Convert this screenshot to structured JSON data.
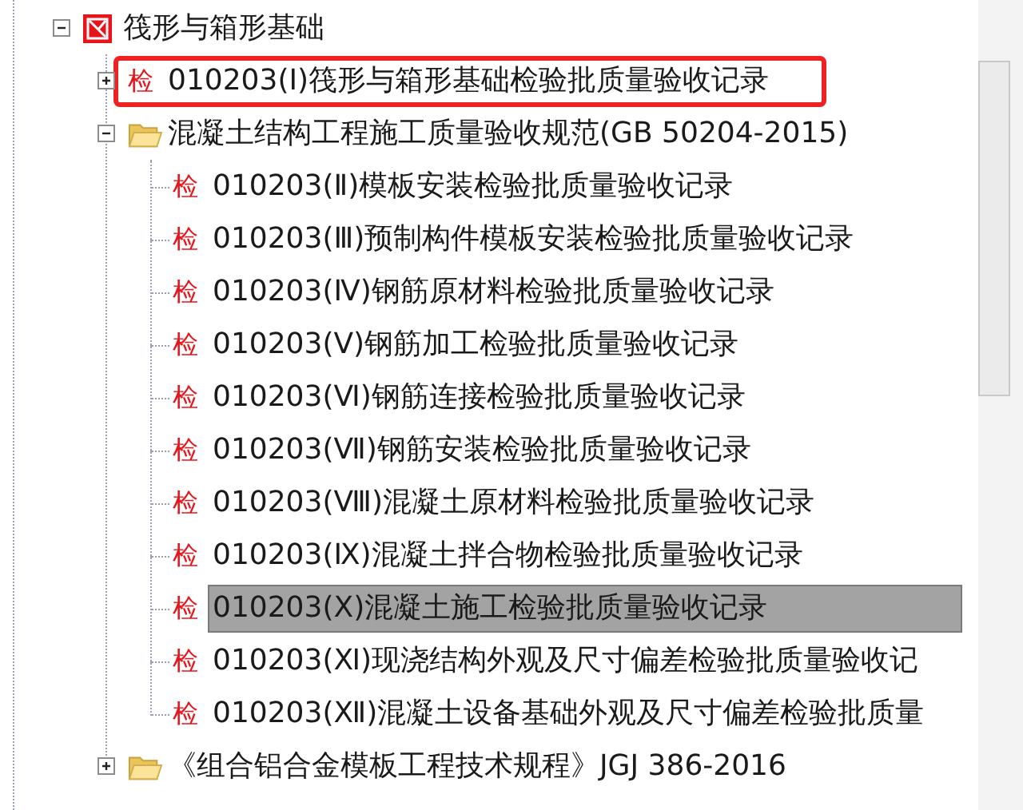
{
  "tree": [
    {
      "kind": "category",
      "label": "筏形与箱形基础",
      "expanded": true,
      "children": [
        {
          "kind": "record",
          "badge": "检",
          "label": "010203(Ⅰ)筏形与箱形基础检验批质量验收记录",
          "expanded": false,
          "marked": true,
          "selected": false
        },
        {
          "kind": "folder",
          "label": "混凝土结构工程施工质量验收规范(GB 50204-2015)",
          "expanded": true,
          "children": [
            {
              "kind": "record",
              "badge": "检",
              "label": "010203(Ⅱ)模板安装检验批质量验收记录",
              "selected": false
            },
            {
              "kind": "record",
              "badge": "检",
              "label": "010203(Ⅲ)预制构件模板安装检验批质量验收记录",
              "selected": false
            },
            {
              "kind": "record",
              "badge": "检",
              "label": "010203(Ⅳ)钢筋原材料检验批质量验收记录",
              "selected": false
            },
            {
              "kind": "record",
              "badge": "检",
              "label": "010203(Ⅴ)钢筋加工检验批质量验收记录",
              "selected": false
            },
            {
              "kind": "record",
              "badge": "检",
              "label": "010203(Ⅵ)钢筋连接检验批质量验收记录",
              "selected": false
            },
            {
              "kind": "record",
              "badge": "检",
              "label": "010203(Ⅶ)钢筋安装检验批质量验收记录",
              "selected": false
            },
            {
              "kind": "record",
              "badge": "检",
              "label": "010203(Ⅷ)混凝土原材料检验批质量验收记录",
              "selected": false
            },
            {
              "kind": "record",
              "badge": "检",
              "label": "010203(Ⅸ)混凝土拌合物检验批质量验收记录",
              "selected": false
            },
            {
              "kind": "record",
              "badge": "检",
              "label": "010203(Ⅹ)混凝土施工检验批质量验收记录",
              "selected": true
            },
            {
              "kind": "record",
              "badge": "检",
              "label": "010203(Ⅺ)现浇结构外观及尺寸偏差检验批质量验收记",
              "selected": false
            },
            {
              "kind": "record",
              "badge": "检",
              "label": "010203(Ⅻ)混凝土设备基础外观及尺寸偏差检验批质量",
              "selected": false
            }
          ]
        },
        {
          "kind": "folder",
          "label": "《组合铝合金模板工程技术规程》JGJ 386-2016",
          "expanded": false
        }
      ]
    }
  ]
}
